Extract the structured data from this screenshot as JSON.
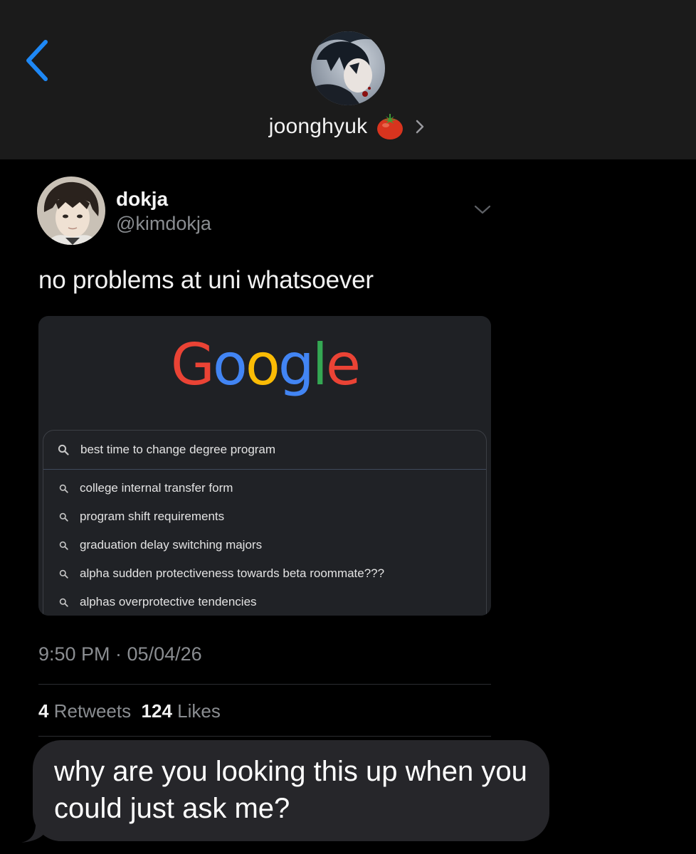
{
  "header": {
    "contact_name": "joonghyuk",
    "contact_emoji": "tomato-icon",
    "back_icon": "chevron-left-icon"
  },
  "tweet": {
    "display_name": "dokja",
    "handle": "@kimdokja",
    "text": "no problems at uni whatsoever",
    "media": {
      "logo_letters": [
        "G",
        "o",
        "o",
        "g",
        "l",
        "e"
      ],
      "logo_colors": [
        "#ea4335",
        "#4285f4",
        "#fbbc05",
        "#4285f4",
        "#34a853",
        "#ea4335"
      ],
      "search_query": "best time to change degree program",
      "suggestions": [
        "college internal transfer form",
        "program shift requirements",
        "graduation delay switching majors",
        "alpha sudden protectiveness towards beta roommate???",
        "alphas overprotective tendencies"
      ]
    },
    "timestamp": "9:50 PM · 05/04/26",
    "retweets_count": "4",
    "retweets_label": "Retweets",
    "likes_count": "124",
    "likes_label": "Likes"
  },
  "message": {
    "text": "why are you looking this up when you could just ask me?"
  },
  "colors": {
    "accent_blue": "#1e88f5",
    "header_bg": "#1b1b1b",
    "bubble_bg": "#26262a",
    "muted_text": "#8a8d91"
  }
}
